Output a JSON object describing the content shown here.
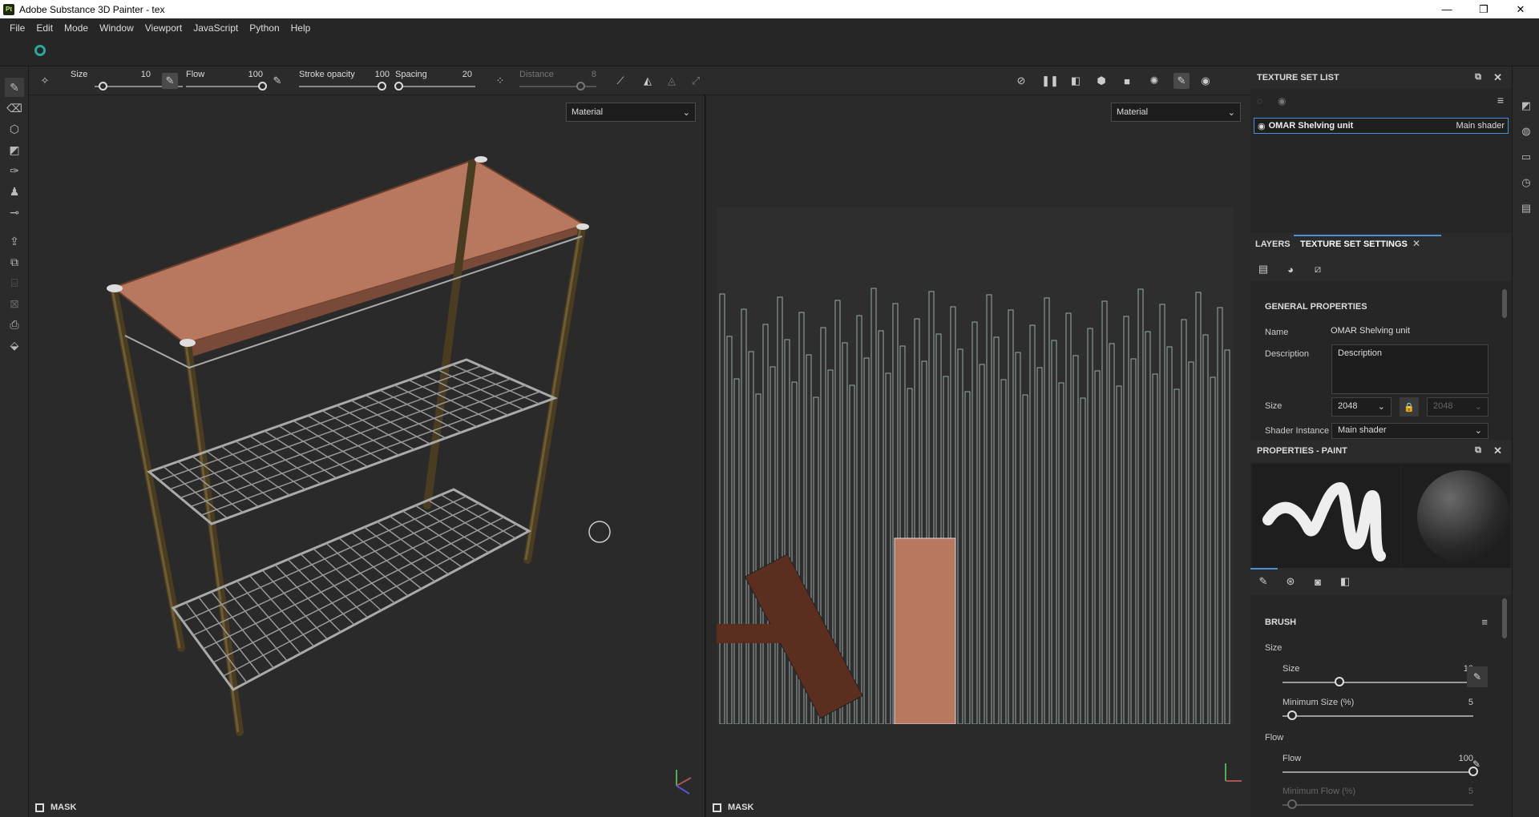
{
  "window": {
    "title": "Adobe Substance 3D Painter - tex",
    "app_badge": "Pt",
    "minimize": "—",
    "restore": "❐",
    "close": "✕"
  },
  "menu": [
    "File",
    "Edit",
    "Mode",
    "Window",
    "Viewport",
    "JavaScript",
    "Python",
    "Help"
  ],
  "toolbar": {
    "size_label": "Size",
    "size_value": "10",
    "size_fraction": 0.1,
    "flow_label": "Flow",
    "flow_value": "100",
    "flow_fraction": 1.0,
    "stroke_opacity_label": "Stroke opacity",
    "stroke_opacity_value": "100",
    "stroke_opacity_fraction": 1.0,
    "spacing_label": "Spacing",
    "spacing_value": "20",
    "spacing_fraction": 0.05,
    "distance_label": "Distance",
    "distance_value": "8",
    "distance_fraction": 0.8
  },
  "viewport3d": {
    "material_select": "Material",
    "mask_label": "MASK"
  },
  "viewport2d": {
    "material_select": "Material",
    "mask_label": "MASK"
  },
  "texture_set_list": {
    "title": "TEXTURE SET LIST",
    "items": [
      {
        "name": "OMAR Shelving unit",
        "shader": "Main shader"
      }
    ]
  },
  "tabs": [
    {
      "label": "LAYERS"
    },
    {
      "label": "TEXTURE SET SETTINGS"
    }
  ],
  "texture_set_settings": {
    "section": "GENERAL PROPERTIES",
    "name_label": "Name",
    "name_value": "OMAR Shelving unit",
    "description_label": "Description",
    "description_value": "Description",
    "size_label": "Size",
    "size_value": "2048",
    "size_value_locked": "2048",
    "shader_instance_label": "Shader Instance",
    "shader_instance_value": "Main shader"
  },
  "properties_paint": {
    "title": "PROPERTIES - PAINT",
    "brush_section": "BRUSH",
    "size_group": "Size",
    "size_label": "Size",
    "size_value": "10",
    "size_fraction": 0.3,
    "min_size_label": "Minimum Size (%)",
    "min_size_value": "5",
    "min_size_fraction": 0.05,
    "flow_group": "Flow",
    "flow_label": "Flow",
    "flow_value": "100",
    "flow_fraction": 1.0,
    "min_flow_label": "Minimum Flow (%)",
    "min_flow_value": "5",
    "min_flow_fraction": 0.05
  },
  "colors": {
    "accent": "#4a8fd8",
    "teal": "#2aa89a",
    "panel_bg": "#262626",
    "viewport_bg": "#2a2a2a"
  }
}
